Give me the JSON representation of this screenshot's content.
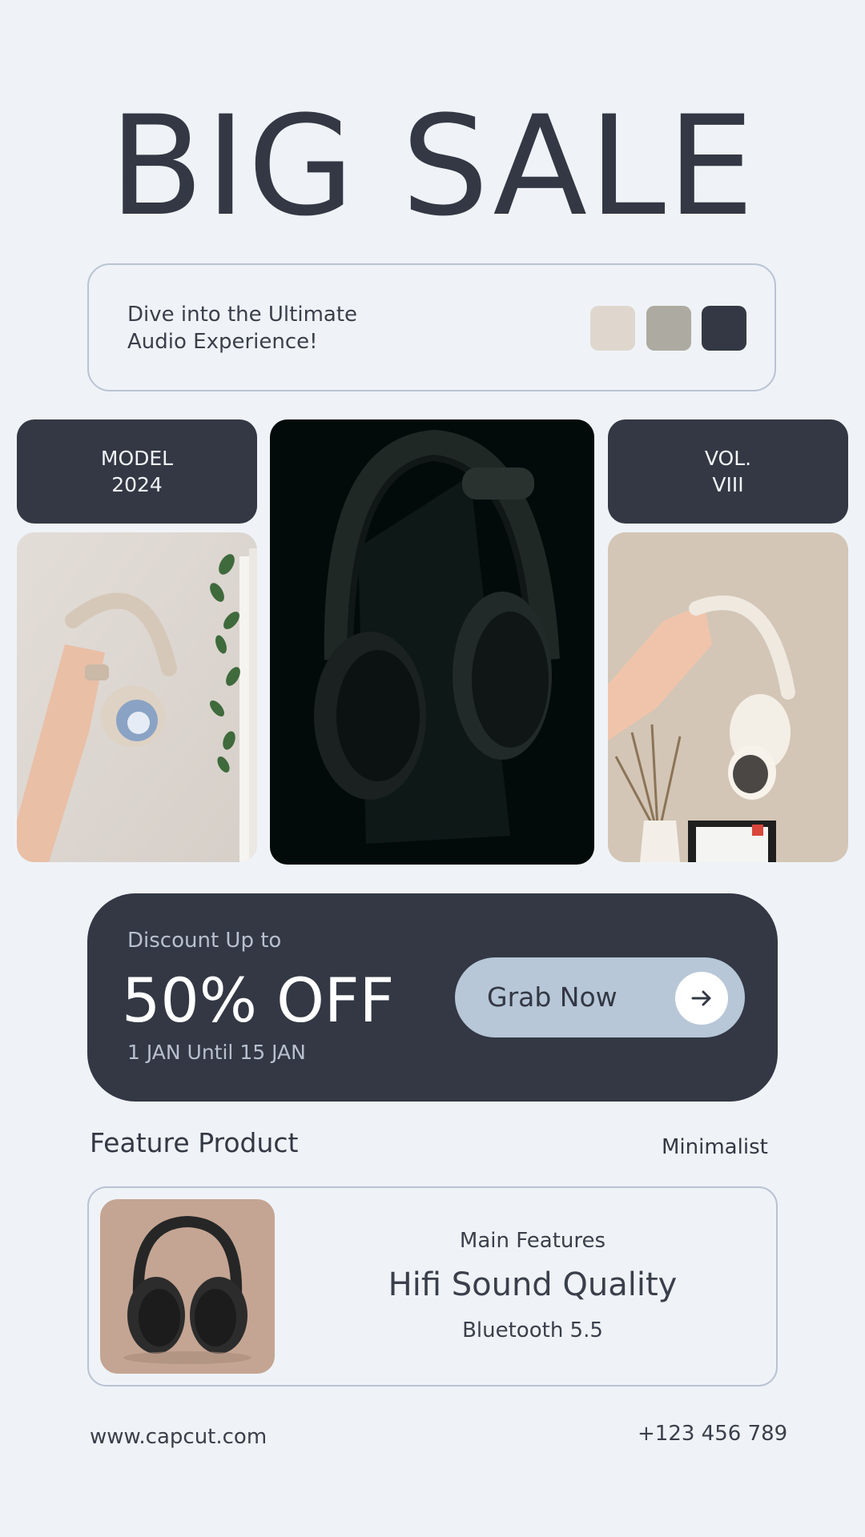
{
  "title": "BIG SALE",
  "intro": {
    "line1": "Dive into the Ultimate",
    "line2": "Audio Experience!",
    "swatches": [
      "#dfd7ce",
      "#adaba1",
      "#333844"
    ]
  },
  "left_tag": {
    "line1": "MODEL",
    "line2": "2024"
  },
  "right_tag": {
    "line1": "VOL.",
    "line2": "VIII"
  },
  "discount": {
    "label": "Discount Up to",
    "amount": "50% OFF",
    "dates": "1 JAN Until 15 JAN",
    "button_label": "Grab Now"
  },
  "feature": {
    "heading": "Feature Product",
    "style": "Minimalist",
    "label": "Main Features",
    "headline": "Hifi Sound Quality",
    "detail": "Bluetooth 5.5"
  },
  "footer": {
    "website": "www.capcut.com",
    "phone": "+123 456 789"
  },
  "colors": {
    "background": "#eff3f7",
    "dark": "#333844",
    "button": "#b7c7d7"
  }
}
